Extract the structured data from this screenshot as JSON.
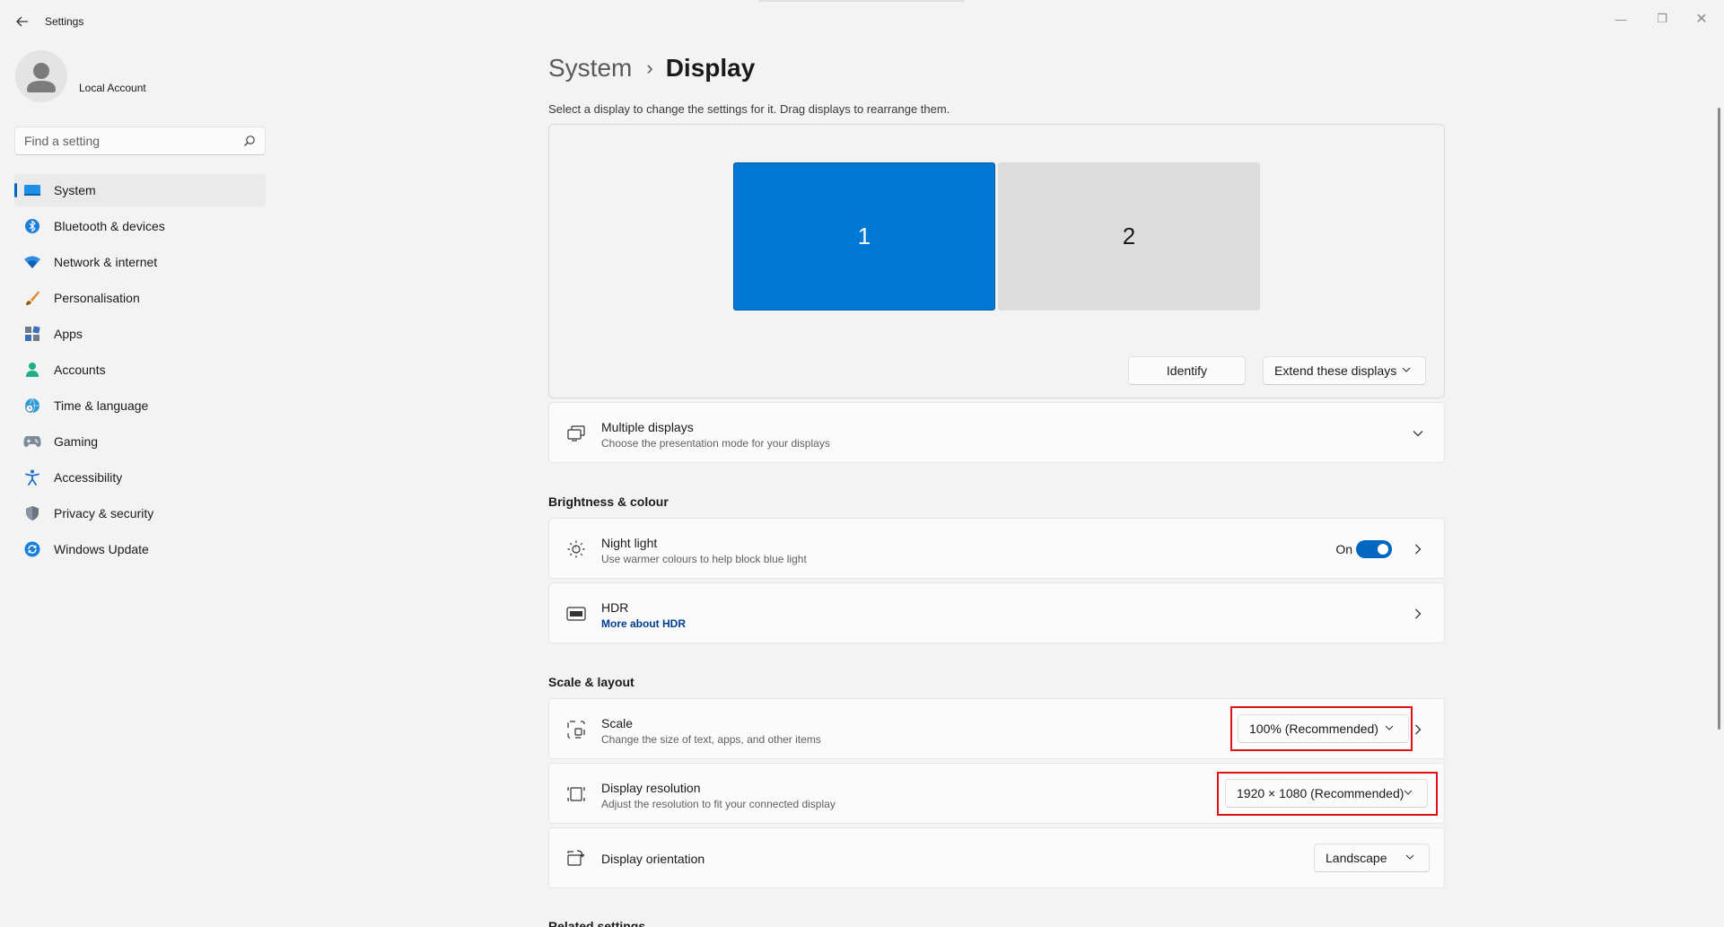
{
  "window": {
    "title": "Settings",
    "minimize_glyph": "—",
    "maximize_glyph": "❐",
    "close_glyph": "✕"
  },
  "user": {
    "name": "Local Account"
  },
  "search": {
    "placeholder": "Find a setting",
    "value": ""
  },
  "sidebar": {
    "items": [
      {
        "label": "System",
        "icon": "system-icon",
        "active": true
      },
      {
        "label": "Bluetooth & devices",
        "icon": "bluetooth-icon"
      },
      {
        "label": "Network & internet",
        "icon": "wifi-icon"
      },
      {
        "label": "Personalisation",
        "icon": "brush-icon"
      },
      {
        "label": "Apps",
        "icon": "apps-icon"
      },
      {
        "label": "Accounts",
        "icon": "accounts-icon"
      },
      {
        "label": "Time & language",
        "icon": "globe-clock-icon"
      },
      {
        "label": "Gaming",
        "icon": "gamepad-icon"
      },
      {
        "label": "Accessibility",
        "icon": "accessibility-icon"
      },
      {
        "label": "Privacy & security",
        "icon": "shield-icon"
      },
      {
        "label": "Windows Update",
        "icon": "update-icon"
      }
    ]
  },
  "header": {
    "parent": "System",
    "separator": "›",
    "current": "Display",
    "description": "Select a display to change the settings for it. Drag displays to rearrange them."
  },
  "arrangement": {
    "monitors": [
      "1",
      "2"
    ],
    "identify_label": "Identify",
    "mode_value": "Extend these displays"
  },
  "multiple_displays": {
    "title": "Multiple displays",
    "subtitle": "Choose the presentation mode for your displays"
  },
  "brightness_section": {
    "title": "Brightness & colour",
    "night_light": {
      "title": "Night light",
      "subtitle": "Use warmer colours to help block blue light",
      "state_label": "On",
      "enabled": true
    },
    "hdr": {
      "title": "HDR",
      "link": "More about HDR"
    }
  },
  "scale_section": {
    "title": "Scale & layout",
    "scale": {
      "title": "Scale",
      "subtitle": "Change the size of text, apps, and other items",
      "value": "100% (Recommended)"
    },
    "resolution": {
      "title": "Display resolution",
      "subtitle": "Adjust the resolution to fit your connected display",
      "value": "1920 × 1080 (Recommended)"
    },
    "orientation": {
      "title": "Display orientation",
      "value": "Landscape"
    }
  },
  "related_section": {
    "title": "Related settings"
  },
  "colors": {
    "accent": "#0067c0",
    "monitor_selected": "#0078d4",
    "highlight": "#e0101b"
  }
}
